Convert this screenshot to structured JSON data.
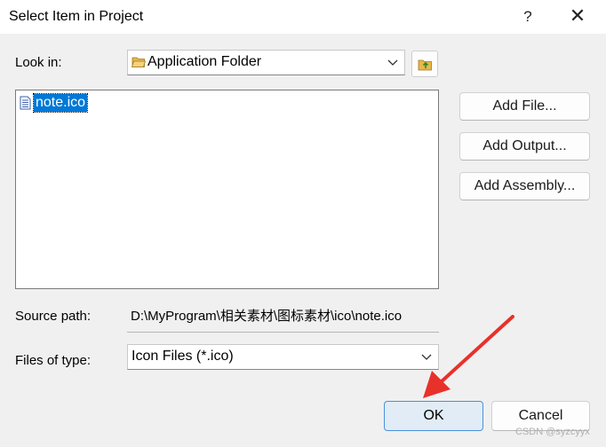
{
  "window": {
    "title": "Select Item in Project",
    "help_glyph": "?",
    "close_glyph": "✕"
  },
  "look_in": {
    "label": "Look in:",
    "value": "Application Folder"
  },
  "file_list": {
    "items": [
      {
        "name": "note.ico",
        "selected": true
      }
    ]
  },
  "side_buttons": {
    "add_file": "Add File...",
    "add_output": "Add Output...",
    "add_assembly": "Add Assembly..."
  },
  "source_path": {
    "label": "Source path:",
    "value": "D:\\MyProgram\\相关素材\\图标素材\\ico\\note.ico"
  },
  "files_of_type": {
    "label": "Files of type:",
    "value": "Icon Files (*.ico)"
  },
  "footer": {
    "ok": "OK",
    "cancel": "Cancel"
  },
  "watermark": "CSDN @syzcyyx",
  "colors": {
    "selection": "#0078d7",
    "annotation_arrow": "#e8312a",
    "ok_border": "#4a90d9"
  }
}
